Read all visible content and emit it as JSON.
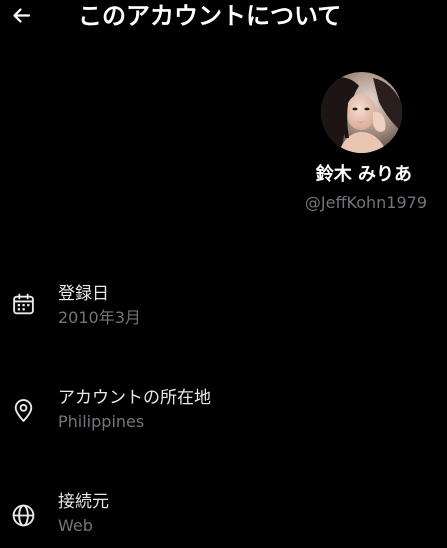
{
  "header": {
    "title": "このアカウントについて",
    "back_icon": "arrow-left-icon"
  },
  "profile": {
    "display_name": "鈴木 みりあ",
    "handle": "@JeffKohn1979"
  },
  "details": [
    {
      "icon": "calendar-icon",
      "label": "登録日",
      "value": "2010年3月"
    },
    {
      "icon": "location-pin-icon",
      "label": "アカウントの所在地",
      "value": "Philippines"
    },
    {
      "icon": "globe-icon",
      "label": "接続元",
      "value": "Web"
    }
  ],
  "colors": {
    "background": "#000000",
    "primary_text": "#e7e9ea",
    "secondary_text": "#71767b"
  }
}
